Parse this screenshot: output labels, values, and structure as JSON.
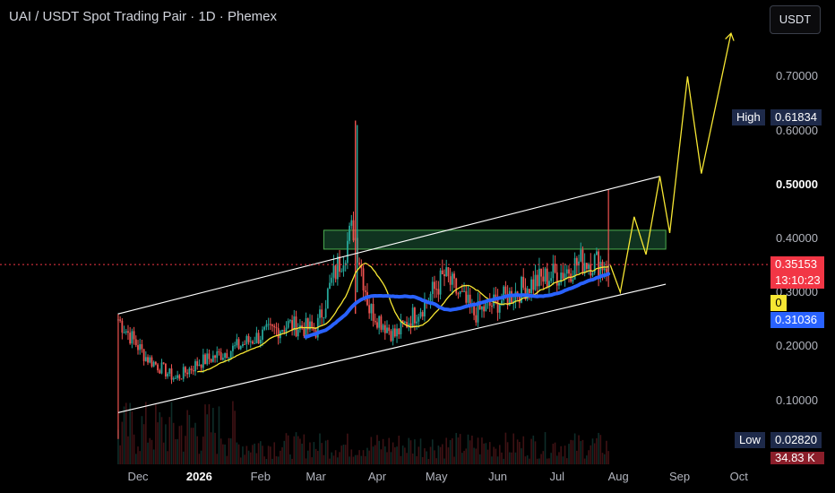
{
  "title": "UAI / USDT Spot Trading Pair · 1D · Phemex",
  "currency_button": "USDT",
  "price_axis": {
    "ticks": [
      {
        "label": "0.70000",
        "value": 0.7,
        "bold": false
      },
      {
        "label": "0.60000",
        "value": 0.6,
        "bold": false
      },
      {
        "label": "0.50000",
        "value": 0.5,
        "bold": true
      },
      {
        "label": "0.40000",
        "value": 0.4,
        "bold": false
      },
      {
        "label": "0.30000",
        "value": 0.3,
        "bold": false
      },
      {
        "label": "0.20000",
        "value": 0.2,
        "bold": false
      },
      {
        "label": "0.10000",
        "value": 0.1,
        "bold": false
      }
    ],
    "high": {
      "label": "High",
      "value": "0.61834"
    },
    "low": {
      "label": "Low",
      "value": "0.02820"
    },
    "last_price": {
      "value": "0.35153",
      "countdown": "13:10:23",
      "color": "#f23645"
    },
    "ma_fast": {
      "value": "0",
      "color": "#f7e733"
    },
    "ma_slow": {
      "value": "0.31036",
      "color": "#2962ff"
    },
    "volume_label": "34.83 K"
  },
  "time_axis": {
    "ticks": [
      {
        "label": "Dec",
        "bold": false
      },
      {
        "label": "2026",
        "bold": true
      },
      {
        "label": "Feb",
        "bold": false
      },
      {
        "label": "Mar",
        "bold": false
      },
      {
        "label": "Apr",
        "bold": false
      },
      {
        "label": "May",
        "bold": false
      },
      {
        "label": "Jun",
        "bold": false
      },
      {
        "label": "Jul",
        "bold": false
      },
      {
        "label": "Aug",
        "bold": false
      },
      {
        "label": "Sep",
        "bold": false
      },
      {
        "label": "Oct",
        "bold": false
      }
    ]
  },
  "colors": {
    "up": "#26a69a",
    "down": "#ef5350",
    "channel": "#ffffff",
    "zone_fill": "#1e5c3a",
    "zone_border": "#4caf50",
    "projection": "#f7e733",
    "ma_fast": "#f7e733",
    "ma_slow": "#2962ff",
    "last_price": "#f23645",
    "tag_bg": "#1e2a4a"
  },
  "chart_data": {
    "type": "candlestick",
    "symbol": "UAI/USDT",
    "interval": "1D",
    "exchange": "Phemex",
    "ylim": [
      0.0,
      0.78
    ],
    "x_range": [
      "2025-11-20",
      "2026-10-08"
    ],
    "price_scale_note": "linear",
    "approx_closes": [
      {
        "date": "2025-11-21",
        "close": 0.25
      },
      {
        "date": "2025-12-05",
        "close": 0.18
      },
      {
        "date": "2025-12-20",
        "close": 0.14
      },
      {
        "date": "2026-01-01",
        "close": 0.17
      },
      {
        "date": "2026-01-15",
        "close": 0.19
      },
      {
        "date": "2026-02-01",
        "close": 0.22
      },
      {
        "date": "2026-02-15",
        "close": 0.24
      },
      {
        "date": "2026-03-01",
        "close": 0.23
      },
      {
        "date": "2026-03-10",
        "close": 0.33
      },
      {
        "date": "2026-03-20",
        "close": 0.42
      },
      {
        "date": "2026-03-28",
        "close": 0.27
      },
      {
        "date": "2026-04-10",
        "close": 0.22
      },
      {
        "date": "2026-04-25",
        "close": 0.28
      },
      {
        "date": "2026-05-05",
        "close": 0.33
      },
      {
        "date": "2026-05-20",
        "close": 0.26
      },
      {
        "date": "2026-06-05",
        "close": 0.29
      },
      {
        "date": "2026-06-20",
        "close": 0.32
      },
      {
        "date": "2026-07-05",
        "close": 0.34
      },
      {
        "date": "2026-07-15",
        "close": 0.36
      },
      {
        "date": "2026-07-27",
        "close": 0.35153
      }
    ],
    "high_of_range": 0.61834,
    "low_of_range": 0.0282,
    "channel": {
      "upper": [
        {
          "date": "2025-11-21",
          "price": 0.26
        },
        {
          "date": "2026-08-22",
          "price": 0.515
        }
      ],
      "lower": [
        {
          "date": "2025-11-21",
          "price": 0.077
        },
        {
          "date": "2026-08-25",
          "price": 0.315
        }
      ]
    },
    "resistance_zone": {
      "from": "2026-03-05",
      "to": "2026-08-25",
      "low": 0.38,
      "high": 0.415
    },
    "projection_path": [
      {
        "date": "2026-07-28",
        "price": 0.35
      },
      {
        "date": "2026-08-02",
        "price": 0.3
      },
      {
        "date": "2026-08-09",
        "price": 0.44
      },
      {
        "date": "2026-08-15",
        "price": 0.37
      },
      {
        "date": "2026-08-22",
        "price": 0.515
      },
      {
        "date": "2026-08-27",
        "price": 0.41
      },
      {
        "date": "2026-09-05",
        "price": 0.7
      },
      {
        "date": "2026-09-12",
        "price": 0.52
      },
      {
        "date": "2026-09-27",
        "price": 0.78
      }
    ]
  }
}
